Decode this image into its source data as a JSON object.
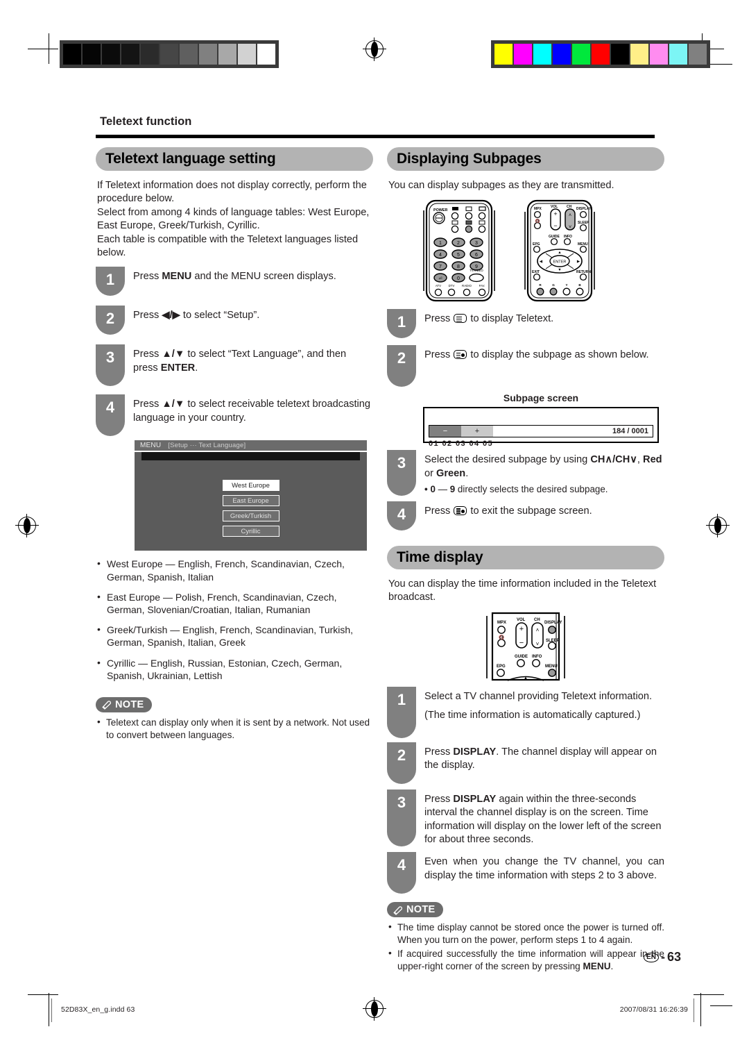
{
  "running_head": "Teletext function",
  "left_column": {
    "section_title": "Teletext language setting",
    "intro": "If Teletext information does not display correctly, perform the procedure below.\nSelect from among 4 kinds of language tables: West Europe, East Europe, Greek/Turkish, Cyrillic.\nEach table is compatible with the Teletext languages listed below.",
    "steps": [
      {
        "num": "1",
        "text_before": "Press ",
        "bold": "MENU",
        "text_after": " and the MENU screen displays."
      },
      {
        "num": "2",
        "text_before": "Press ",
        "bold": "◀/▶",
        "text_after": " to select “Setup”."
      },
      {
        "num": "3",
        "text_before": "Press ",
        "bold": "▲/▼",
        "text_after": " to select “Text Language”, and then press ",
        "bold2": "ENTER",
        "text_end": "."
      },
      {
        "num": "4",
        "text_before": "Press ",
        "bold": "▲/▼",
        "text_after": " to select receivable teletext broadcasting language in your country."
      }
    ],
    "menu_screen": {
      "title": "MENU",
      "breadcrumb": "[Setup ··· Text Language]",
      "options": [
        {
          "label": "West Europe",
          "selected": true
        },
        {
          "label": "East Europe",
          "selected": false
        },
        {
          "label": "Greek/Turkish",
          "selected": false
        },
        {
          "label": "Cyrillic",
          "selected": false
        }
      ]
    },
    "language_tables": [
      "West Europe — English, French, Scandinavian, Czech, German, Spanish, Italian",
      "East Europe — Polish, French, Scandinavian, Czech, German, Slovenian/Croatian, Italian, Rumanian",
      "Greek/Turkish — English, French, Scandinavian, Turkish, German, Spanish, Italian, Greek",
      "Cyrillic — English, Russian, Estonian, Czech, German, Spanish, Ukrainian, Lettish"
    ],
    "note": {
      "label": "NOTE",
      "items": [
        "Teletext can display only when it is sent by a network. Not used to convert between languages."
      ]
    }
  },
  "right_column": {
    "subpages": {
      "section_title": "Displaying Subpages",
      "intro": "You can display subpages as they are transmitted.",
      "steps": [
        {
          "num": "1",
          "text_before": "Press ",
          "icon": "teletext-icon",
          "text_after": " to display Teletext."
        },
        {
          "num": "2",
          "text_before": "Press ",
          "icon": "subpage-icon",
          "text_after": " to display the subpage as shown below."
        },
        {
          "num": "3",
          "text_before": "Select the desired subpage by using ",
          "bold": "CH∧/CH∨",
          "text_after": ", ",
          "bold2": "Red",
          "text_mid": " or ",
          "bold3": "Green",
          "text_end": ".",
          "sub_bullet_bold_a": "0",
          "sub_bullet_mid": " — ",
          "sub_bullet_bold_b": "9",
          "sub_bullet_after": " directly selects the desired subpage."
        },
        {
          "num": "4",
          "text_before": "Press ",
          "icon": "subpage-icon",
          "text_after": " to exit the subpage screen."
        }
      ],
      "subpage_screen": {
        "title": "Subpage screen",
        "minus": "−",
        "plus": "+",
        "page_number": "184 / 0001",
        "subpage_numbers": "01  02  03  04  05"
      }
    },
    "time_display": {
      "section_title": "Time display",
      "intro": "You can display the time information included in the Teletext broadcast.",
      "steps": [
        {
          "num": "1",
          "text": "Select a TV channel providing Teletext information.",
          "extra": "(The time information is automatically captured.)"
        },
        {
          "num": "2",
          "text_before": "Press ",
          "bold": "DISPLAY",
          "text_after": ". The channel display will appear on the display."
        },
        {
          "num": "3",
          "text_before": "Press ",
          "bold": "DISPLAY",
          "text_after": " again within the three-seconds interval the channel display is on the screen. Time information will display on the lower left of the screen for about three seconds."
        },
        {
          "num": "4",
          "text": "Even when you change the TV channel, you can display the time information with steps 2 to 3 above."
        }
      ],
      "note": {
        "label": "NOTE",
        "items": [
          "The time display cannot be stored once the power is turned off. When you turn on the power, perform steps 1 to 4 again.",
          "If acquired successfully the time information will appear in the upper-right corner of the screen by pressing MENU."
        ],
        "item2_bold_tail": "MENU"
      }
    }
  },
  "remotes": {
    "full_remote_left": {
      "labels": [
        "POWER",
        "1",
        "2",
        "3",
        "4",
        "5",
        "6",
        "7",
        "8",
        "9",
        "0",
        "TV/VIDEO",
        "ATV",
        "DTV",
        "RADIO",
        "FAV."
      ]
    },
    "full_remote_right": {
      "labels": [
        "MPX",
        "VOL",
        "CH",
        "DISPLAY",
        "SLEEP",
        "GUIDE",
        "INFO",
        "EPG",
        "MENU",
        "ENTER",
        "EXIT",
        "RETURN",
        "R",
        "G",
        "Y",
        "B"
      ]
    },
    "time_remote": {
      "labels": [
        "MPX",
        "VOL",
        "CH",
        "DISPLAY",
        "SLEEP",
        "GUIDE",
        "INFO",
        "EPG",
        "MENU"
      ]
    }
  },
  "page_number": {
    "locale": "EN",
    "separator": "-",
    "number": "63"
  },
  "footer": {
    "file": "52D83X_en_g.indd   63",
    "timestamp": "2007/08/31   16:26:39"
  },
  "print_bars": {
    "grayscale": [
      "#000000",
      "#050505",
      "#0b0b0b",
      "#141414",
      "#2b2b2b",
      "#464646",
      "#5f5f5f",
      "#808080",
      "#a8a8a8",
      "#d2d2d2",
      "#ffffff"
    ],
    "colors": [
      "#ffff00",
      "#ff00ff",
      "#00ffff",
      "#0000ff",
      "#00e83c",
      "#ff0000",
      "#000000",
      "#ffef88",
      "#ff8cf0",
      "#7cf5f5",
      "#808080"
    ]
  }
}
